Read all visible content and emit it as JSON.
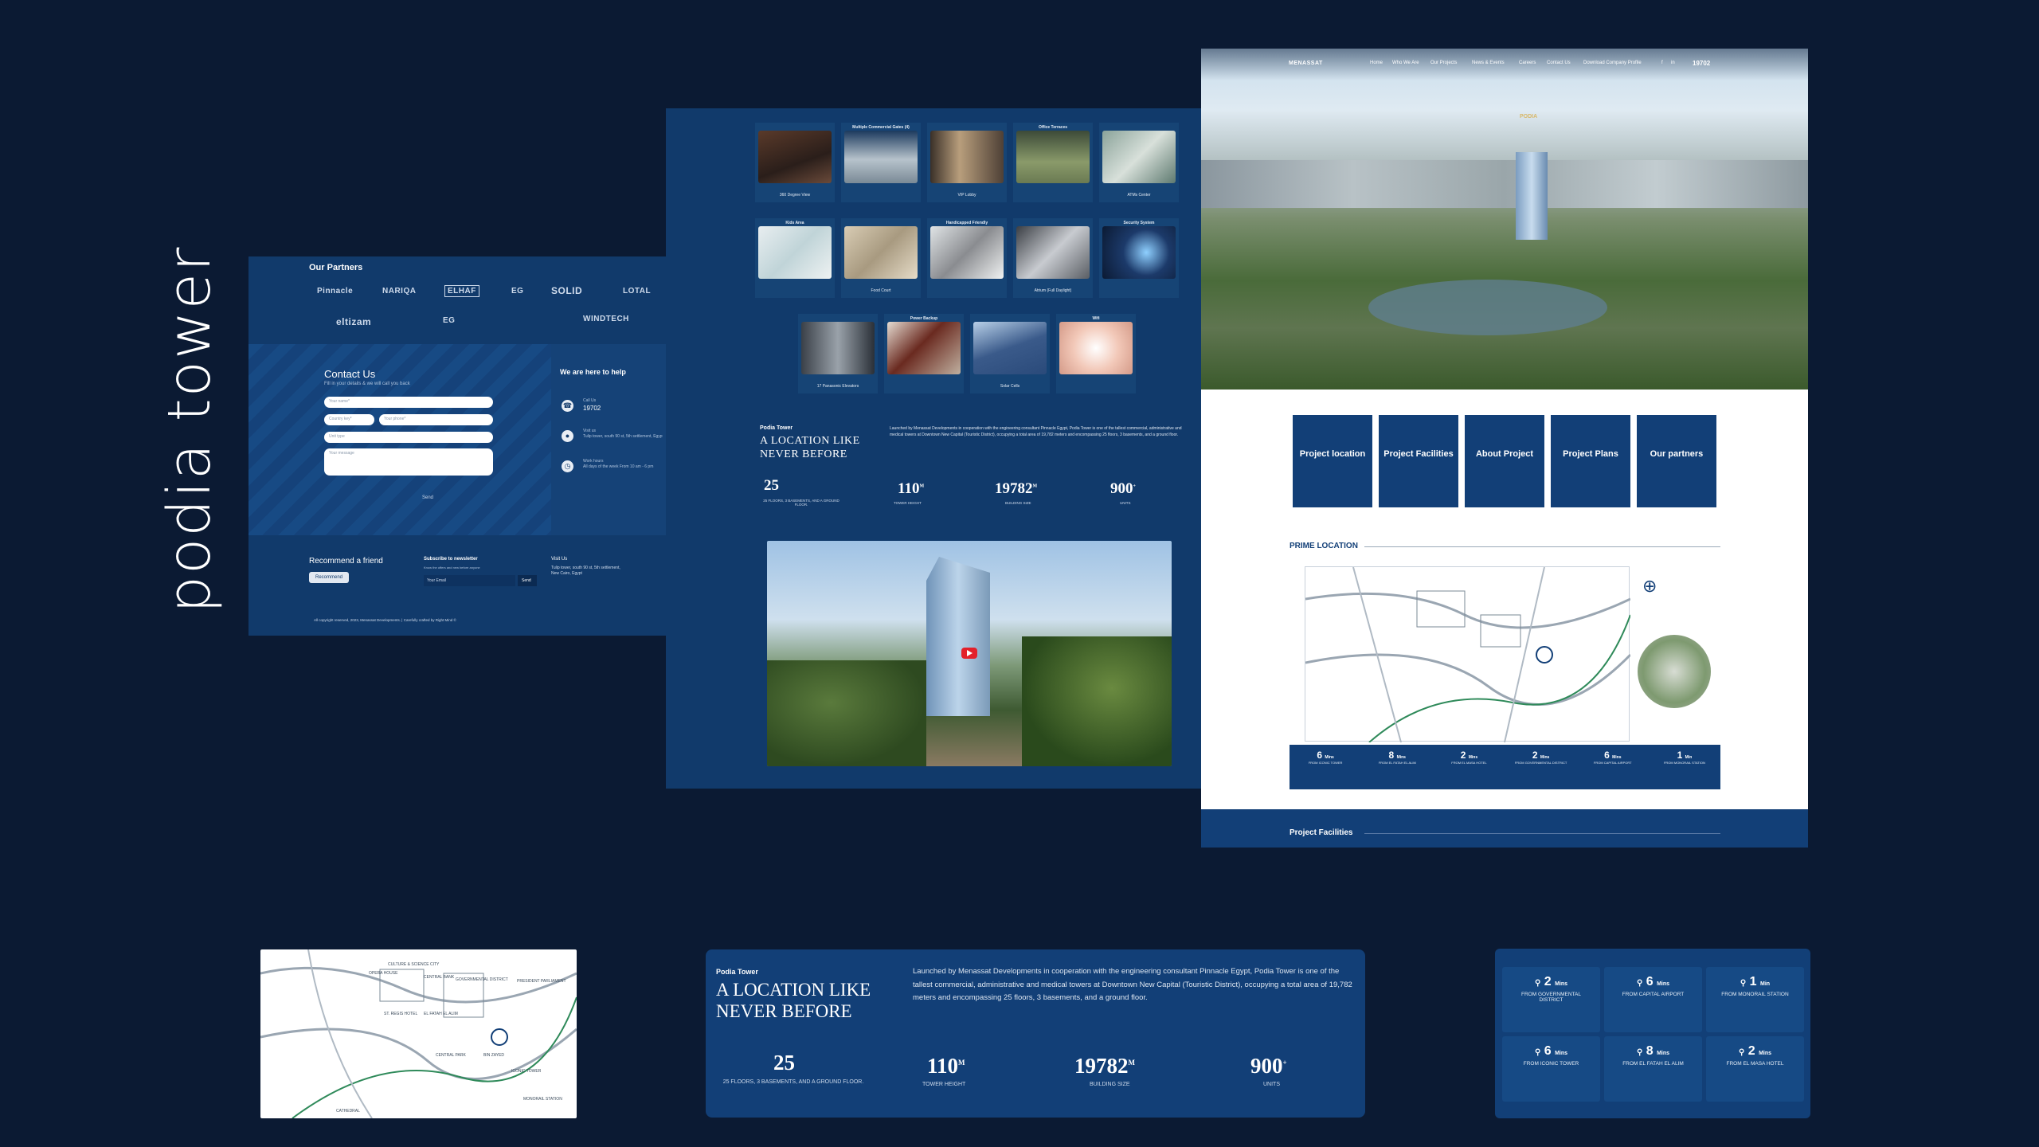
{
  "page_title": "podia tower",
  "footer_panel": {
    "partners_title": "Our Partners",
    "partners_row1": [
      "Pinnacle",
      "NARIQA",
      "ELHAF",
      "EG",
      "SOLID",
      "LOTAL"
    ],
    "partners_row2": [
      "eltizam",
      "EG",
      "",
      "WINDTECH"
    ],
    "contact": {
      "title": "Contact Us",
      "subtitle": "Fill in your details & we will call you back",
      "name_placeholder": "Your name*",
      "country_placeholder": "Country key*",
      "phone_placeholder": "Your phone*",
      "unit_placeholder": "Unit type",
      "message_placeholder": "Your message",
      "send_label": "Send"
    },
    "help": {
      "title": "We are here to help",
      "call_label": "Call Us",
      "call_value": "19702",
      "visit_label": "Visit us",
      "visit_value": "Tulip tower, south 90 st, 5th settlement, Egypt",
      "hours_label": "Work hours",
      "hours_value": "All days of the week From 10 am - 6 pm"
    },
    "recommend_title": "Recommend a friend",
    "recommend_btn": "Recommend",
    "newsletter_title": "Subscribe to newsletter",
    "newsletter_sub": "Know the offers and new before anyone",
    "email_placeholder": "Your Email",
    "newsletter_btn": "Send",
    "visit_title": "Visit Us",
    "visit_addr": "Tulip tower, south 90 st, 5th settlement, New Cairo, Egypt",
    "copyright": "All copyright reserved, 2023, Menassat Developments. | Carefully crafted by Right Mind ©"
  },
  "facilities_panel": {
    "cards_row1": [
      "360 Degree View",
      "Multiple Commercial Gates (4)",
      "VIP Lobby",
      "Office Terraces",
      "ATMs Center"
    ],
    "cards_row1_top": [
      "",
      "Multiple Commercial Gates (4)",
      "",
      "Office Terraces",
      ""
    ],
    "cards_row2_top": [
      "Kids Area",
      "",
      "Handicapped Friendly",
      "",
      "Security System"
    ],
    "cards_row2": [
      "",
      "Food Court",
      "",
      "Atrium (Full Daylight)",
      ""
    ],
    "cards_row3_top": [
      "",
      "Power Backup",
      "",
      "Wifi"
    ],
    "cards_row3": [
      "17 Panasonic Elevators",
      "",
      "Solar Cells",
      ""
    ],
    "eyebrow": "Podia Tower",
    "heading_line1": "A LOCATION LIKE",
    "heading_line2": "NEVER BEFORE",
    "paragraph": "Launched by Menassat Developments in cooperation with the engineering consultant Pinnacle Egypt, Podia Tower is one of the tallest commercial, administrative and medical towers at Downtown New Capital (Touristic District), occupying a total area of 19,782 meters and encompassing 25 floors, 3 basements, and a ground floor.",
    "stats": [
      {
        "num": "25",
        "label": "25 floors, 3 basements, and a ground floor."
      },
      {
        "num": "110",
        "sup": "M",
        "label": "Tower height"
      },
      {
        "num": "19782",
        "sup": "M",
        "label": "Building size"
      },
      {
        "num": "900",
        "sup": "+",
        "label": "Units"
      }
    ]
  },
  "home_panel": {
    "logo": "MENASSAT",
    "nav": [
      "Home",
      "Who We Are",
      "Our Projects",
      "News & Events",
      "Careers",
      "Contact Us",
      "Download Company Profile",
      "f",
      "in",
      "19702"
    ],
    "hero_brand": "PODIA",
    "tiles": [
      "Project location",
      "Project Facilities",
      "About Project",
      "Project Plans",
      "Our partners"
    ],
    "prime_location": "PRIME LOCATION",
    "distances": [
      {
        "num": "6",
        "unit": "Mins",
        "label": "From Iconic Tower"
      },
      {
        "num": "8",
        "unit": "Mins",
        "label": "From El Fatah El Alim"
      },
      {
        "num": "2",
        "unit": "Mins",
        "label": "From El Masa Hotel"
      },
      {
        "num": "2",
        "unit": "Mins",
        "label": "From Governmental District"
      },
      {
        "num": "6",
        "unit": "Mins",
        "label": "From Capital Airport"
      },
      {
        "num": "1",
        "unit": "Min",
        "label": "From Monorail Station"
      }
    ],
    "facilities_title": "Project Facilities"
  },
  "map_labels": [
    "OPERA HOUSE",
    "CULTURE & SCIENCE CITY",
    "CENTRAL BANK",
    "GOVERNMENTAL DISTRICT",
    "PRESIDENT PARLIAMENT",
    "ST. REGIS HOTEL",
    "EL FATAH EL ALIM",
    "CENTRAL PARK",
    "MONORAIL STATION",
    "CATHEDRAL",
    "BIN ZAYED",
    "ICONIC TOWER"
  ],
  "callout_text": {
    "eyebrow": "Podia Tower",
    "heading_line1": "A LOCATION LIKE",
    "heading_line2": "NEVER BEFORE",
    "paragraph": "Launched by Menassat Developments in cooperation with the engineering consultant Pinnacle Egypt, Podia Tower is one of the tallest commercial, administrative and medical towers at Downtown New Capital (Touristic District), occupying a total area of 19,782 meters and encompassing 25 floors, 3 basements, and a ground floor.",
    "stats": [
      {
        "num": "25",
        "sup": "",
        "label": "25 floors, 3 basements, and a ground floor."
      },
      {
        "num": "110",
        "sup": "M",
        "label": "Tower height"
      },
      {
        "num": "19782",
        "sup": "M",
        "label": "Building size"
      },
      {
        "num": "900",
        "sup": "+",
        "label": "Units"
      }
    ]
  },
  "callout_distances": [
    {
      "num": "2",
      "unit": "Mins",
      "label": "From Governmental District"
    },
    {
      "num": "6",
      "unit": "Mins",
      "label": "From Capital Airport"
    },
    {
      "num": "1",
      "unit": "Min",
      "label": "From Monorail Station"
    },
    {
      "num": "6",
      "unit": "Mins",
      "label": "From Iconic Tower"
    },
    {
      "num": "8",
      "unit": "Mins",
      "label": "From El Fatah El Alim"
    },
    {
      "num": "2",
      "unit": "Mins",
      "label": "From El Masa Hotel"
    }
  ],
  "colors": {
    "background": "#0b1a33",
    "navy": "#123f77",
    "panel": "#113a6b"
  }
}
